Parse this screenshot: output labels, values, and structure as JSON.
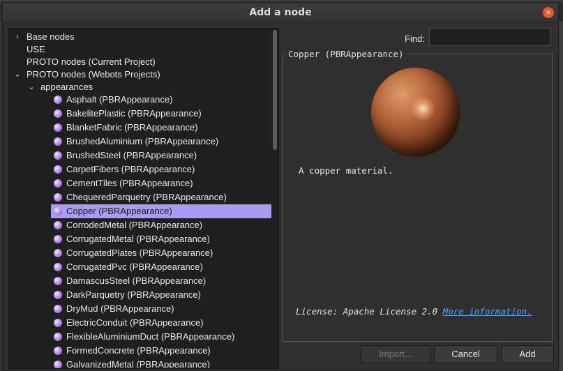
{
  "dialog": {
    "title": "Add a node",
    "close_glyph": "×"
  },
  "find": {
    "label": "Find:",
    "value": ""
  },
  "tree": {
    "top_items": [
      {
        "label": "Base nodes",
        "arrow": "›"
      },
      {
        "label": "USE",
        "arrow": ""
      },
      {
        "label": "PROTO nodes (Current Project)",
        "arrow": ""
      },
      {
        "label": "PROTO nodes (Webots Projects)",
        "arrow": "⌄"
      }
    ],
    "folder": {
      "label": "appearances",
      "arrow": "⌄"
    },
    "nodes": [
      "Asphalt (PBRAppearance)",
      "BakelitePlastic (PBRAppearance)",
      "BlanketFabric (PBRAppearance)",
      "BrushedAluminium (PBRAppearance)",
      "BrushedSteel (PBRAppearance)",
      "CarpetFibers (PBRAppearance)",
      "CementTiles (PBRAppearance)",
      "ChequeredParquetry (PBRAppearance)",
      "Copper (PBRAppearance)",
      "CorrodedMetal (PBRAppearance)",
      "CorrugatedMetal (PBRAppearance)",
      "CorrugatedPlates (PBRAppearance)",
      "CorrugatedPvc (PBRAppearance)",
      "DamascusSteel (PBRAppearance)",
      "DarkParquetry (PBRAppearance)",
      "DryMud (PBRAppearance)",
      "ElectricConduit (PBRAppearance)",
      "FlexibleAluminiumDuct (PBRAppearance)",
      "FormedConcrete (PBRAppearance)",
      "GalvanizedMetal (PBRAppearance)"
    ],
    "selected_index": 8
  },
  "preview": {
    "title": "Copper (PBRAppearance)",
    "description": "A copper material.",
    "license_text": "License: Apache License 2.0",
    "more_link": "More information."
  },
  "buttons": {
    "import": "Import...",
    "cancel": "Cancel",
    "add": "Add"
  },
  "colors": {
    "selection": "#a79cf2",
    "link": "#5aa0e6",
    "close_button": "#e95420"
  }
}
